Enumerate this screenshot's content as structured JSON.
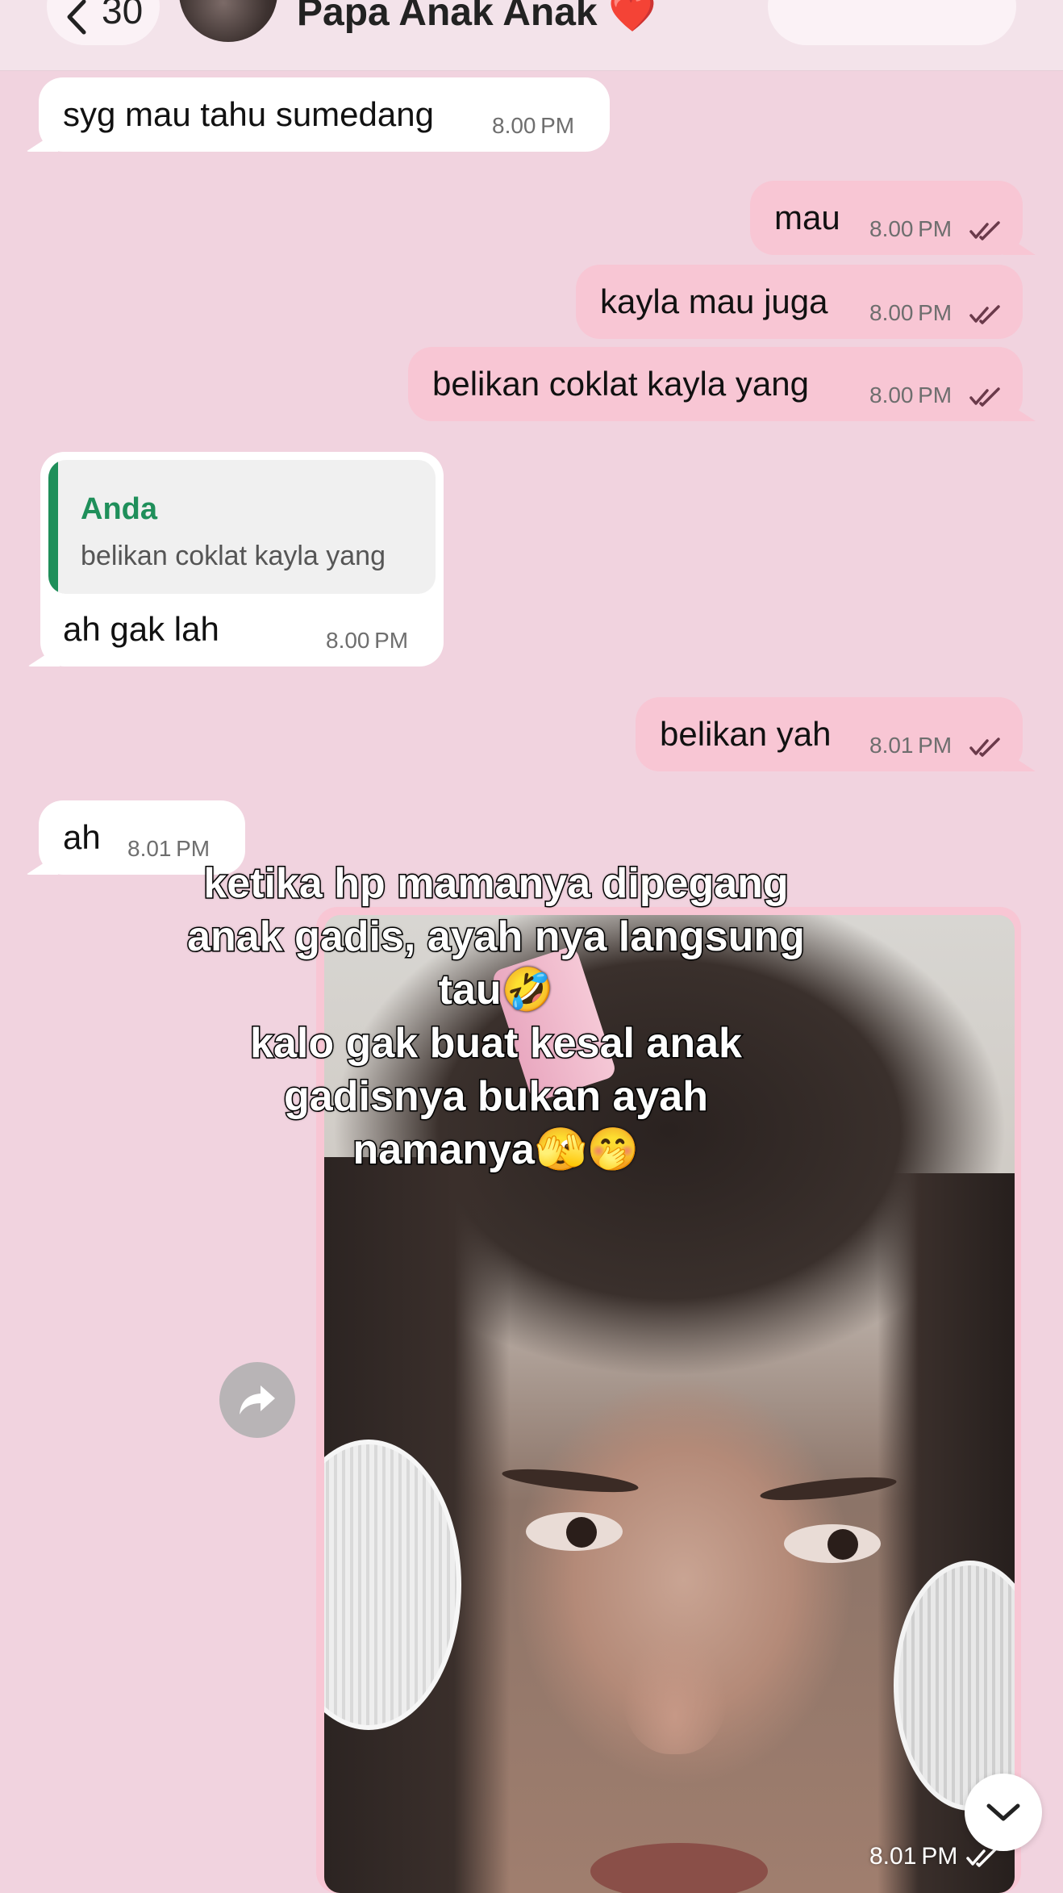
{
  "header": {
    "back_count": "30",
    "chat_name": "Papa Anak Anak",
    "chat_name_emoji": "❤️"
  },
  "messages": [
    {
      "direction": "in",
      "text": "syg mau tahu sumedang",
      "time": "8.00 PM"
    },
    {
      "direction": "out",
      "text": "mau",
      "time": "8.00 PM"
    },
    {
      "direction": "out",
      "text": "kayla mau juga",
      "time": "8.00 PM"
    },
    {
      "direction": "out",
      "text": "belikan coklat kayla yang",
      "time": "8.00 PM"
    },
    {
      "direction": "in",
      "text": "ah gak lah",
      "time": "8.00 PM",
      "reply": {
        "author": "Anda",
        "text": "belikan coklat kayla yang"
      }
    },
    {
      "direction": "out",
      "text": "belikan yah",
      "time": "8.01 PM"
    },
    {
      "direction": "in",
      "text": "ah",
      "time": "8.01 PM"
    },
    {
      "direction": "out",
      "type": "image",
      "time": "8.01 PM"
    }
  ],
  "caption": {
    "lines": [
      "ketika hp mamanya dipegang",
      "anak gadis, ayah nya langsung",
      "tau🤣",
      "kalo gak buat kesal anak",
      "gadisnya bukan ayah",
      "namanya🫣🤭"
    ]
  },
  "icons": {
    "back": "chevron-left-icon",
    "video": "video-camera-icon",
    "phone": "phone-icon",
    "ticks": "double-check-icon",
    "forward": "forward-arrow-icon",
    "scroll": "chevron-down-icon"
  },
  "colors": {
    "background": "#f1d3df",
    "outgoing_bubble": "#f8c6d4",
    "incoming_bubble": "#ffffff",
    "reply_accent": "#1f8f5a",
    "read_ticks": "#6a3a4a"
  }
}
